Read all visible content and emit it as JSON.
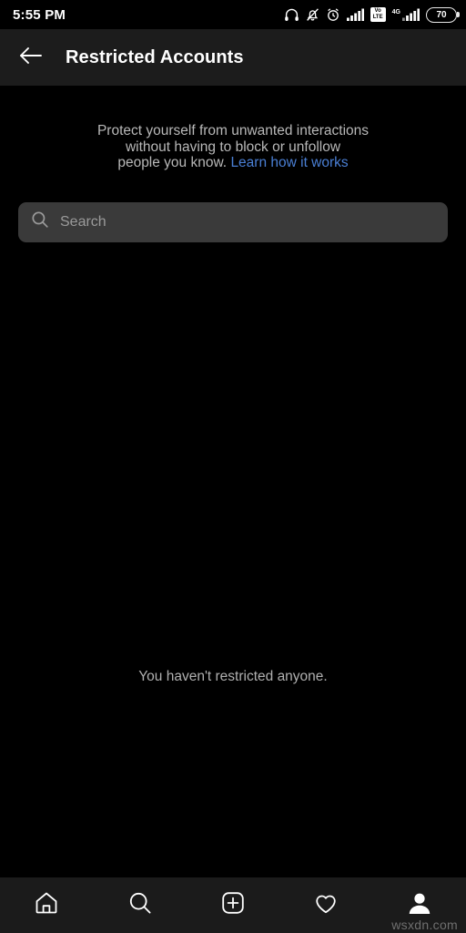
{
  "status_bar": {
    "time": "5:55 PM",
    "battery_level": "70",
    "volte_top": "Vo",
    "volte_bottom": "LTE",
    "network_label": "4G",
    "icons": [
      "headphones-icon",
      "bell-muted-icon",
      "alarm-clock-icon",
      "signal-bars-icon",
      "volte-badge-icon",
      "signal-bars-4g-icon",
      "battery-icon"
    ]
  },
  "header": {
    "back_icon": "back-arrow-icon",
    "title": "Restricted Accounts"
  },
  "main": {
    "description_line1": "Protect yourself from unwanted interactions",
    "description_line2": "without having to block or unfollow",
    "description_line3": "people you know.",
    "learn_link": "Learn how it works",
    "empty_state": "You haven't restricted anyone."
  },
  "search": {
    "placeholder": "Search",
    "value": "",
    "icon": "search-icon"
  },
  "tabbar": {
    "items": [
      {
        "name": "home",
        "icon": "home-icon",
        "active": false
      },
      {
        "name": "search",
        "icon": "search-icon",
        "active": false
      },
      {
        "name": "create",
        "icon": "plus-square-icon",
        "active": false
      },
      {
        "name": "activity",
        "icon": "heart-icon",
        "active": false
      },
      {
        "name": "profile",
        "icon": "person-icon",
        "active": true
      }
    ]
  },
  "watermark": "wsxdn.com",
  "colors": {
    "background": "#000000",
    "surface": "#1c1c1c",
    "search_field": "#3a3a3a",
    "link": "#4a7fd4",
    "text_primary": "#ffffff",
    "text_secondary": "#b8b8b8"
  }
}
